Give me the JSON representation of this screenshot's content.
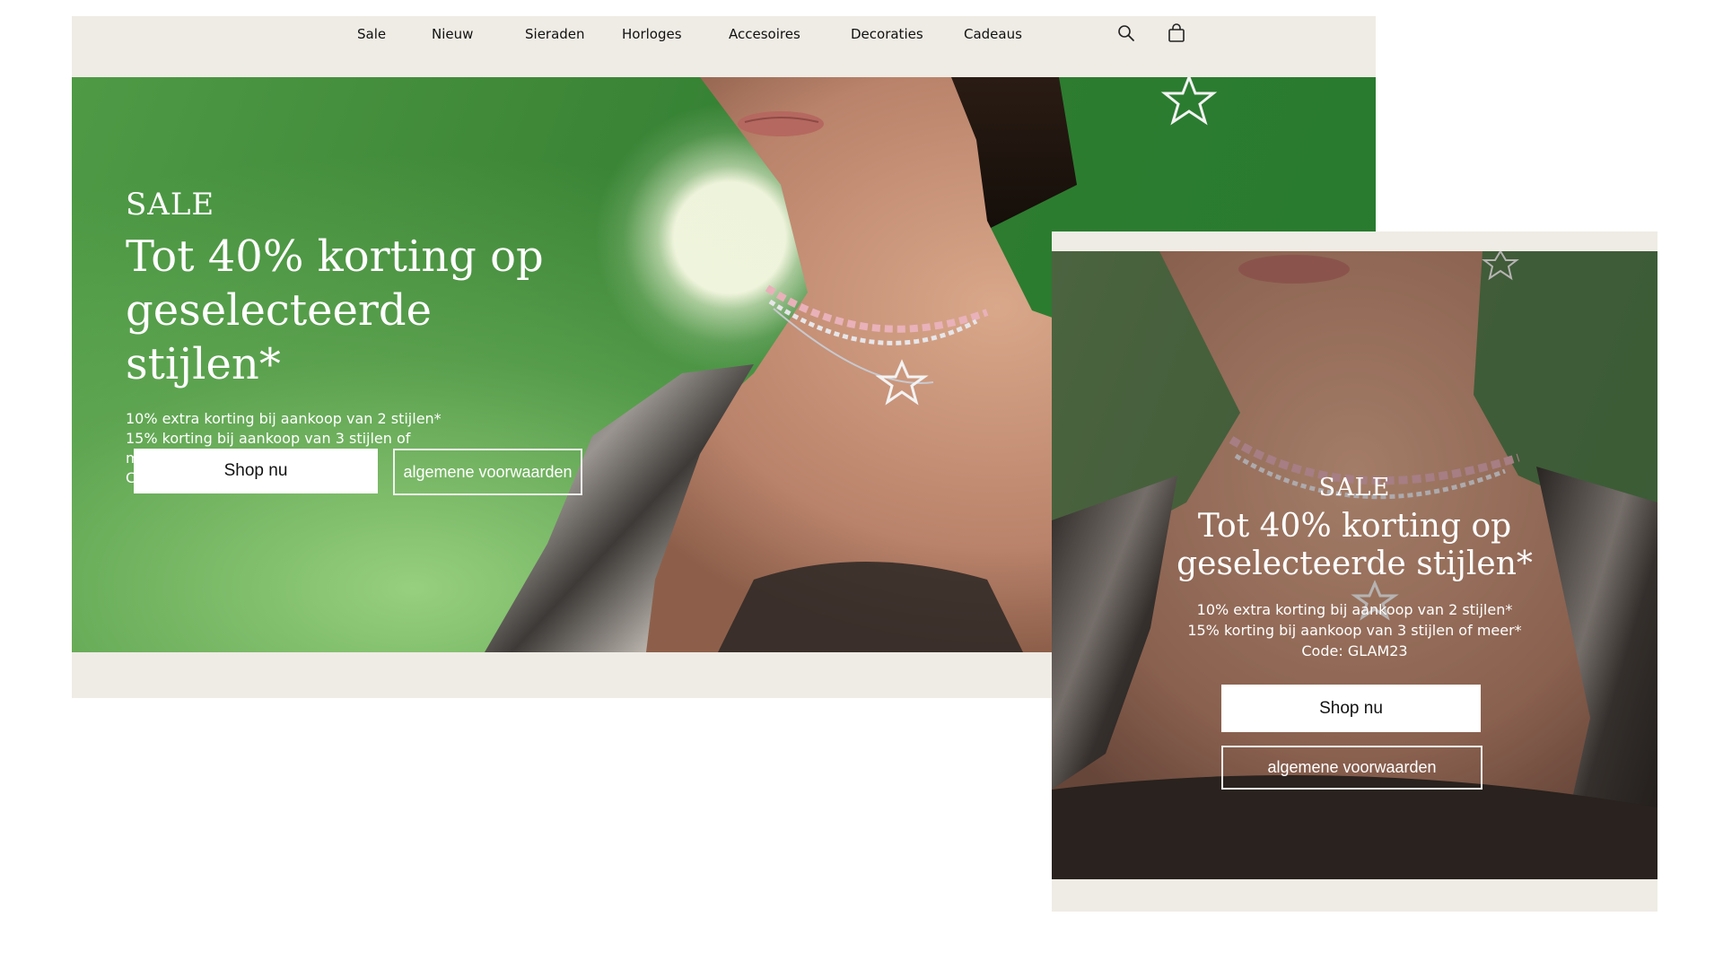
{
  "nav": {
    "items": [
      {
        "label": "Sale"
      },
      {
        "label": "Nieuw"
      },
      {
        "label": "Sieraden"
      },
      {
        "label": "Horloges"
      },
      {
        "label": "Accesoires"
      },
      {
        "label": "Decoraties"
      },
      {
        "label": "Cadeaus"
      }
    ],
    "icons": [
      "search-icon",
      "shopping-bag-icon"
    ]
  },
  "desktop_hero": {
    "eyebrow": "SALE",
    "headline": "Tot 40% korting op geselecteerde stijlen*",
    "lines": [
      "10% extra korting bij aankoop van 2 stijlen*",
      "15% korting bij aankoop van 3 stijlen of meer*",
      "Code: GLAM23"
    ],
    "primary_button": "Shop nu",
    "secondary_button": "algemene voorwaarden"
  },
  "mobile_hero": {
    "eyebrow": "SALE",
    "headline": "Tot 40% korting op geselecteerde stijlen*",
    "lines": [
      "10% extra korting bij aankoop van 2 stijlen*",
      "15% korting bij aankoop van 3 stijlen of meer*",
      "Code: GLAM23"
    ],
    "primary_button": "Shop nu",
    "secondary_button": "algemene voorwaarden"
  },
  "colors": {
    "page_background": "#ffffff",
    "chrome_background": "#efece5",
    "hero_green": "#2f7d31",
    "button_background": "#ffffff",
    "text_light": "#ffffff",
    "text_dark": "#111111"
  }
}
